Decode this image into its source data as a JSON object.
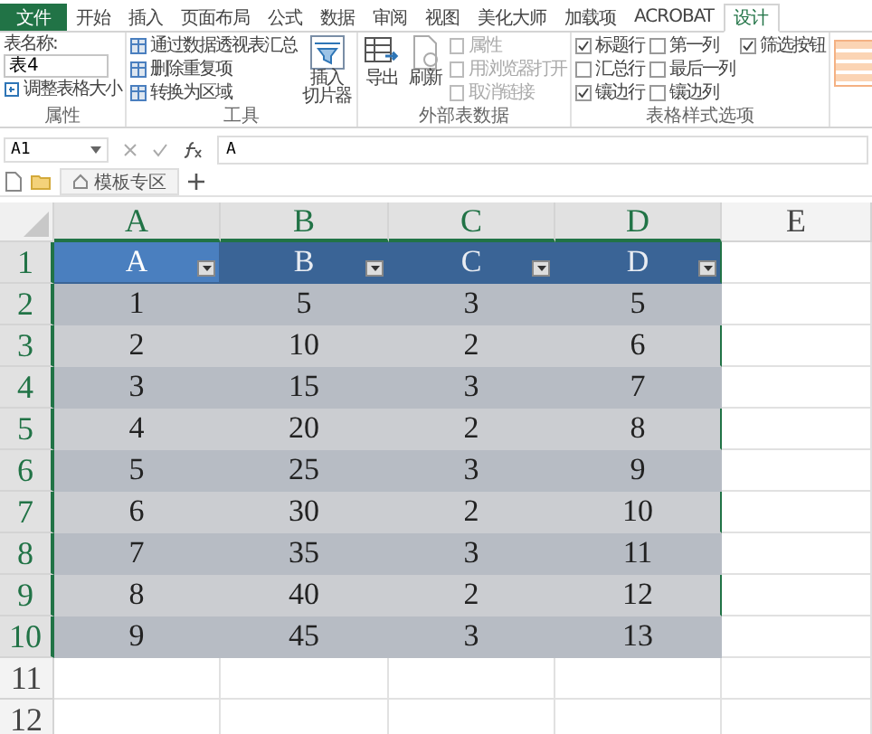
{
  "ribbon_tabs": [
    {
      "label": "文件",
      "selected": false,
      "kind": "file"
    },
    {
      "label": "开始",
      "selected": false,
      "kind": "tab"
    },
    {
      "label": "插入",
      "selected": false,
      "kind": "tab"
    },
    {
      "label": "页面布局",
      "selected": false,
      "kind": "tab"
    },
    {
      "label": "公式",
      "selected": false,
      "kind": "tab"
    },
    {
      "label": "数据",
      "selected": false,
      "kind": "tab"
    },
    {
      "label": "审阅",
      "selected": false,
      "kind": "tab"
    },
    {
      "label": "视图",
      "selected": false,
      "kind": "tab"
    },
    {
      "label": "美化大师",
      "selected": false,
      "kind": "tab"
    },
    {
      "label": "加载项",
      "selected": false,
      "kind": "tab"
    },
    {
      "label": "ACROBAT",
      "selected": false,
      "kind": "tab"
    },
    {
      "label": "设计",
      "selected": true,
      "kind": "tab"
    }
  ],
  "properties_group": {
    "table_name_label": "表名称:",
    "table_name_value": "表4",
    "resize_button": "调整表格大小",
    "group_label": "属性"
  },
  "tools_group": {
    "items": [
      "通过数据透视表汇总",
      "删除重复项",
      "转换为区域"
    ],
    "slicer_button": [
      "插入",
      "切片器"
    ],
    "group_label": "工具"
  },
  "external_group": {
    "export_button": "导出",
    "refresh_button": "刷新",
    "items": [
      {
        "label": "属性",
        "disabled": true
      },
      {
        "label": "用浏览器打开",
        "disabled": true
      },
      {
        "label": "取消链接",
        "disabled": true
      }
    ],
    "group_label": "外部表数据"
  },
  "style_options_group": {
    "options": [
      {
        "label": "标题行",
        "checked": true
      },
      {
        "label": "汇总行",
        "checked": false
      },
      {
        "label": "镶边行",
        "checked": true
      },
      {
        "label": "第一列",
        "checked": false
      },
      {
        "label": "最后一列",
        "checked": false
      },
      {
        "label": "镶边列",
        "checked": false
      },
      {
        "label": "筛选按钮",
        "checked": true
      }
    ],
    "group_label": "表格样式选项"
  },
  "formula_bar": {
    "name_box": "A1",
    "value": "A"
  },
  "sheet_tabs": [
    {
      "label": "模板专区"
    }
  ],
  "columns": [
    {
      "label": "A",
      "selected": true
    },
    {
      "label": "B",
      "selected": true
    },
    {
      "label": "C",
      "selected": true
    },
    {
      "label": "D",
      "selected": true
    },
    {
      "label": "E",
      "selected": false
    }
  ],
  "row_headers": [
    "1",
    "2",
    "3",
    "4",
    "5",
    "6",
    "7",
    "8",
    "9",
    "10",
    "11",
    "12"
  ],
  "table": {
    "header": [
      {
        "label": "A",
        "selected": true
      },
      {
        "label": "B",
        "selected": false
      },
      {
        "label": "C",
        "selected": false
      },
      {
        "label": "D",
        "selected": false
      }
    ],
    "rows": [
      [
        "1",
        "5",
        "3",
        "5"
      ],
      [
        "2",
        "10",
        "2",
        "6"
      ],
      [
        "3",
        "15",
        "3",
        "7"
      ],
      [
        "4",
        "20",
        "2",
        "8"
      ],
      [
        "5",
        "25",
        "3",
        "9"
      ],
      [
        "6",
        "30",
        "2",
        "10"
      ],
      [
        "7",
        "35",
        "3",
        "11"
      ],
      [
        "8",
        "40",
        "2",
        "12"
      ],
      [
        "9",
        "45",
        "3",
        "13"
      ]
    ]
  }
}
